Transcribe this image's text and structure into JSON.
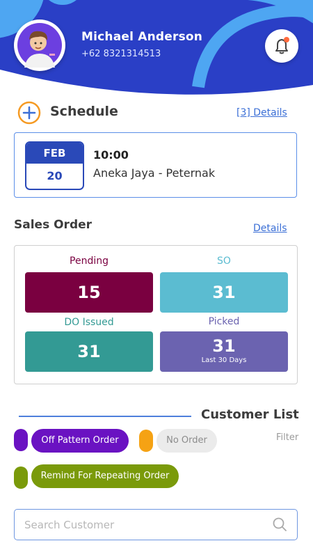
{
  "profile": {
    "name": "Michael Anderson",
    "phone": "+62 8321314513"
  },
  "schedule": {
    "title": "Schedule",
    "details_link": "[3] Details",
    "event": {
      "month": "FEB",
      "day": "20",
      "time": "10:00",
      "place": "Aneka Jaya - Peternak"
    }
  },
  "sales_order": {
    "title": "Sales Order",
    "details_link": "Details",
    "stats": [
      {
        "label": "Pending",
        "value": "15",
        "color": "#7a0040",
        "label_color": "#7a0040"
      },
      {
        "label": "SO",
        "value": "31",
        "color": "#5bbcd1",
        "label_color": "#5bbcd1"
      },
      {
        "label": "DO Issued",
        "value": "31",
        "color": "#339a94",
        "label_color": "#339a94"
      },
      {
        "label": "Picked",
        "value": "31",
        "sub": "Last 30 Days",
        "color": "#6b63b0",
        "label_color": "#6b63b0"
      }
    ]
  },
  "customer_list": {
    "title": "Customer List",
    "filter_label": "Filter",
    "legend": [
      {
        "label": "Off Pattern Order",
        "color": "#6a12c2"
      },
      {
        "label": "No Order",
        "color": "#f5a214"
      },
      {
        "label": "Remind For Repeating Order",
        "color": "#7a9a0a"
      }
    ],
    "search_placeholder": "Search Customer"
  },
  "colors": {
    "header_dark": "#2a3fc6",
    "header_light": "#4ea6f2",
    "accent": "#3b6fd6",
    "add_icon": "#f59a23"
  },
  "icons": {
    "avatar": "avatar",
    "notification": "bell-icon",
    "add": "plus-circle-icon",
    "search": "search-icon"
  }
}
